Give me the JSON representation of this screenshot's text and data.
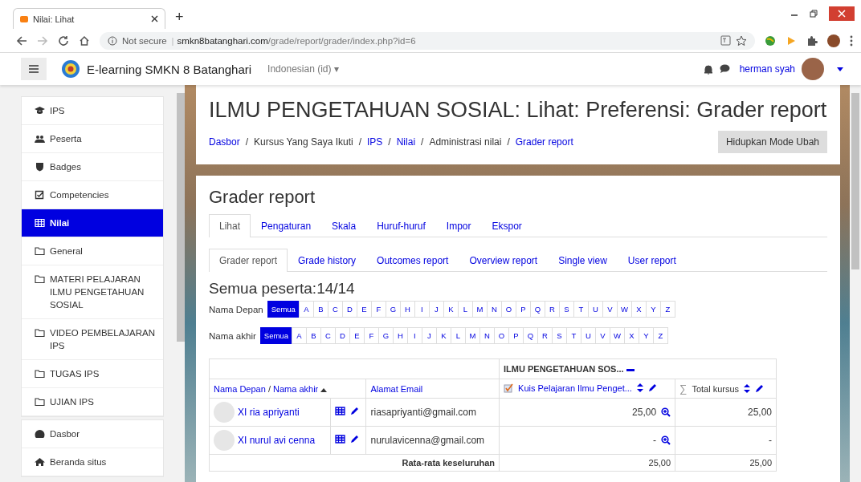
{
  "browser": {
    "tab_title": "Nilai: Lihat",
    "new_tab": "+",
    "security": "Not secure",
    "url_separator": "|",
    "url_host": "smkn8batanghari.com",
    "url_path": "/grade/report/grader/index.php?id=6"
  },
  "navbar": {
    "site_name": "E-learning SMKN 8 Batanghari",
    "language": "Indonesian (id)",
    "language_caret": "▾",
    "user_name": "herman syah"
  },
  "sidebar": [
    {
      "label": "IPS",
      "kind": "course",
      "selected": false
    },
    {
      "label": "Peserta",
      "kind": "participants",
      "selected": false
    },
    {
      "label": "Badges",
      "kind": "badges",
      "selected": false
    },
    {
      "label": "Competencies",
      "kind": "competencies",
      "selected": false
    },
    {
      "label": "Nilai",
      "kind": "grades",
      "selected": true
    },
    {
      "label": "General",
      "kind": "section",
      "selected": false
    },
    {
      "label": "MATERI PELAJARAN ILMU PENGETAHUAN SOSIAL",
      "kind": "section",
      "selected": false
    },
    {
      "label": "VIDEO PEMBELAJARAN IPS",
      "kind": "section",
      "selected": false
    },
    {
      "label": "TUGAS IPS",
      "kind": "section",
      "selected": false
    },
    {
      "label": "UJIAN IPS",
      "kind": "section",
      "selected": false
    }
  ],
  "sidebar_bottom": [
    {
      "label": "Dasbor",
      "kind": "dashboard",
      "selected": false
    },
    {
      "label": "Beranda situs",
      "kind": "home",
      "selected": false
    }
  ],
  "header": {
    "title": "ILMU PENGETAHUAN SOSIAL: Lihat: Preferensi: Grader report",
    "separator": "/",
    "breadcrumbs": [
      {
        "label": "Dasbor",
        "link": true
      },
      {
        "label": "Kursus Yang Saya Ikuti",
        "link": false
      },
      {
        "label": "IPS",
        "link": true
      },
      {
        "label": "Nilai",
        "link": true
      },
      {
        "label": "Administrasi nilai",
        "link": false
      },
      {
        "label": "Grader report",
        "link": true
      }
    ],
    "button": "Hidupkan Mode Ubah"
  },
  "report": {
    "heading": "Grader report",
    "tabs": [
      {
        "label": "Lihat",
        "selected": true
      },
      {
        "label": "Pengaturan",
        "selected": false
      },
      {
        "label": "Skala",
        "selected": false
      },
      {
        "label": "Huruf-huruf",
        "selected": false
      },
      {
        "label": "Impor",
        "selected": false
      },
      {
        "label": "Ekspor",
        "selected": false
      }
    ],
    "subtabs": [
      {
        "label": "Grader report",
        "selected": true
      },
      {
        "label": "Grade history",
        "selected": false
      },
      {
        "label": "Outcomes report",
        "selected": false
      },
      {
        "label": "Overview report",
        "selected": false
      },
      {
        "label": "Single view",
        "selected": false
      },
      {
        "label": "User report",
        "selected": false
      }
    ],
    "participants": "Semua peserta:14/14",
    "filters": [
      {
        "label": "Nama Depan",
        "letters": [
          {
            "label": "Semua",
            "selected": true
          },
          {
            "label": "A",
            "selected": false
          },
          {
            "label": "B",
            "selected": false
          },
          {
            "label": "C",
            "selected": false
          },
          {
            "label": "D",
            "selected": false
          },
          {
            "label": "E",
            "selected": false
          },
          {
            "label": "F",
            "selected": false
          },
          {
            "label": "G",
            "selected": false
          },
          {
            "label": "H",
            "selected": false
          },
          {
            "label": "I",
            "selected": false
          },
          {
            "label": "J",
            "selected": false
          },
          {
            "label": "K",
            "selected": false
          },
          {
            "label": "L",
            "selected": false
          },
          {
            "label": "M",
            "selected": false
          },
          {
            "label": "N",
            "selected": false
          },
          {
            "label": "O",
            "selected": false
          },
          {
            "label": "P",
            "selected": false
          },
          {
            "label": "Q",
            "selected": false
          },
          {
            "label": "R",
            "selected": false
          },
          {
            "label": "S",
            "selected": false
          },
          {
            "label": "T",
            "selected": false
          },
          {
            "label": "U",
            "selected": false
          },
          {
            "label": "V",
            "selected": false
          },
          {
            "label": "W",
            "selected": false
          },
          {
            "label": "X",
            "selected": false
          },
          {
            "label": "Y",
            "selected": false
          },
          {
            "label": "Z",
            "selected": false
          }
        ]
      },
      {
        "label": "Nama akhir",
        "letters": [
          {
            "label": "Semua",
            "selected": true
          },
          {
            "label": "A",
            "selected": false
          },
          {
            "label": "B",
            "selected": false
          },
          {
            "label": "C",
            "selected": false
          },
          {
            "label": "D",
            "selected": false
          },
          {
            "label": "E",
            "selected": false
          },
          {
            "label": "F",
            "selected": false
          },
          {
            "label": "G",
            "selected": false
          },
          {
            "label": "H",
            "selected": false
          },
          {
            "label": "I",
            "selected": false
          },
          {
            "label": "J",
            "selected": false
          },
          {
            "label": "K",
            "selected": false
          },
          {
            "label": "L",
            "selected": false
          },
          {
            "label": "M",
            "selected": false
          },
          {
            "label": "N",
            "selected": false
          },
          {
            "label": "O",
            "selected": false
          },
          {
            "label": "P",
            "selected": false
          },
          {
            "label": "Q",
            "selected": false
          },
          {
            "label": "R",
            "selected": false
          },
          {
            "label": "S",
            "selected": false
          },
          {
            "label": "T",
            "selected": false
          },
          {
            "label": "U",
            "selected": false
          },
          {
            "label": "V",
            "selected": false
          },
          {
            "label": "W",
            "selected": false
          },
          {
            "label": "X",
            "selected": false
          },
          {
            "label": "Y",
            "selected": false
          },
          {
            "label": "Z",
            "selected": false
          }
        ]
      }
    ],
    "table": {
      "category": "ILMU PENGETAHUAN SOS...",
      "name_first": "Nama Depan",
      "name_separator": "/",
      "name_last": "Nama akhir",
      "email": "Alamat Email",
      "quiz": "Kuis Pelajaran Ilmu Penget...",
      "sigma": "∑",
      "total": "Total kursus",
      "rows": [
        {
          "name": "XI ria apriyanti",
          "email": "riasapriyanti@gmail.com",
          "quiz": "25,00",
          "total": "25,00"
        },
        {
          "name": "XI nurul avi cenna",
          "email": "nurulavicenna@gmail.com",
          "quiz": "-",
          "total": "-"
        }
      ],
      "average": {
        "label": "Rata-rata keseluruhan",
        "quiz": "25,00",
        "total": "25,00"
      }
    }
  }
}
